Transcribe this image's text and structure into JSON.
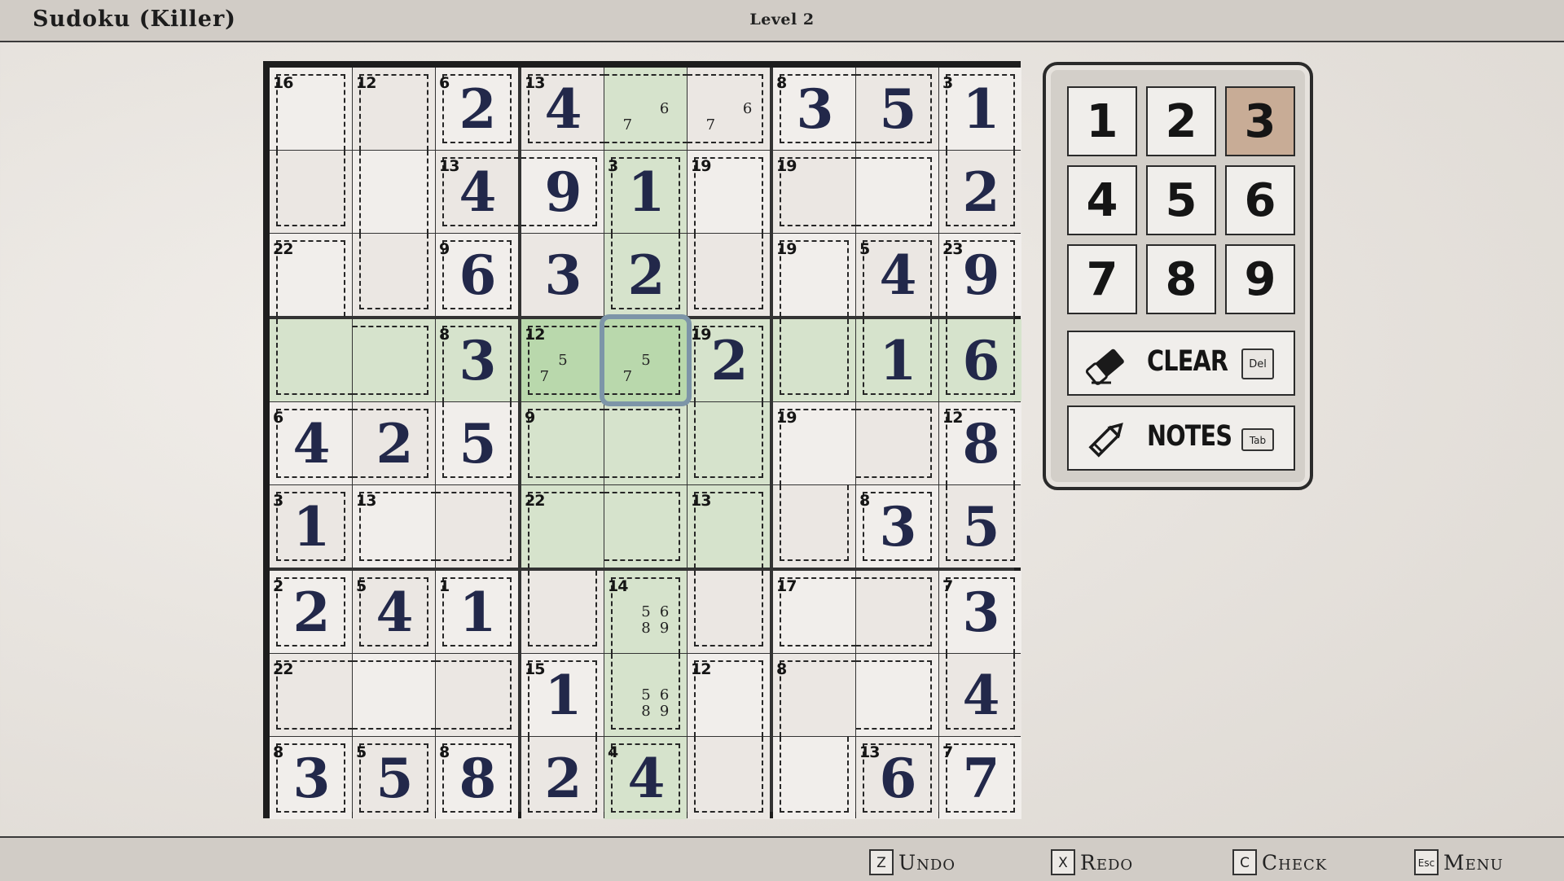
{
  "header": {
    "title": "Sudoku (Killer)",
    "level": "Level 2"
  },
  "colors": {
    "highlight": "#d6e3cc",
    "selected_fill": "#b9d8ac",
    "selected_ring": "#7d95a8",
    "active_number": "#c8ac96",
    "cell": "#f1eeeb",
    "cell_alt": "#ebe7e3"
  },
  "board": {
    "selected_cell": [
      3,
      4
    ],
    "active_number": 3,
    "values": [
      [
        null,
        null,
        2,
        4,
        null,
        null,
        3,
        5,
        1
      ],
      [
        null,
        null,
        4,
        9,
        1,
        null,
        null,
        null,
        2
      ],
      [
        null,
        null,
        6,
        3,
        2,
        null,
        null,
        4,
        9
      ],
      [
        null,
        null,
        3,
        null,
        null,
        2,
        null,
        1,
        6
      ],
      [
        4,
        2,
        5,
        null,
        null,
        null,
        null,
        null,
        8
      ],
      [
        1,
        null,
        null,
        null,
        null,
        null,
        null,
        3,
        5
      ],
      [
        2,
        4,
        1,
        null,
        null,
        null,
        null,
        null,
        3
      ],
      [
        null,
        null,
        null,
        1,
        null,
        null,
        null,
        null,
        4
      ],
      [
        3,
        5,
        8,
        2,
        4,
        null,
        null,
        6,
        7
      ]
    ],
    "notes": [
      {
        "row": 0,
        "col": 4,
        "digits": [
          6,
          7
        ]
      },
      {
        "row": 0,
        "col": 5,
        "digits": [
          6,
          7
        ]
      },
      {
        "row": 3,
        "col": 3,
        "digits": [
          5,
          7
        ]
      },
      {
        "row": 3,
        "col": 4,
        "digits": [
          5,
          7
        ]
      },
      {
        "row": 6,
        "col": 4,
        "digits": [
          5,
          6,
          8,
          9
        ]
      },
      {
        "row": 7,
        "col": 4,
        "digits": [
          5,
          6,
          8,
          9
        ]
      }
    ],
    "cages": [
      {
        "sum": 16,
        "cells": [
          [
            0,
            0
          ],
          [
            1,
            0
          ]
        ]
      },
      {
        "sum": 12,
        "cells": [
          [
            0,
            1
          ],
          [
            1,
            1
          ],
          [
            2,
            1
          ]
        ]
      },
      {
        "sum": 6,
        "cells": [
          [
            0,
            2
          ]
        ]
      },
      {
        "sum": 13,
        "cells": [
          [
            0,
            3
          ],
          [
            0,
            4
          ],
          [
            0,
            5
          ]
        ]
      },
      {
        "sum": 8,
        "cells": [
          [
            0,
            6
          ],
          [
            0,
            7
          ]
        ]
      },
      {
        "sum": 3,
        "cells": [
          [
            0,
            8
          ],
          [
            1,
            8
          ]
        ]
      },
      {
        "sum": 13,
        "cells": [
          [
            1,
            2
          ],
          [
            1,
            3
          ]
        ]
      },
      {
        "sum": 3,
        "cells": [
          [
            1,
            4
          ],
          [
            2,
            4
          ]
        ]
      },
      {
        "sum": 19,
        "cells": [
          [
            1,
            5
          ],
          [
            2,
            5
          ]
        ]
      },
      {
        "sum": 19,
        "cells": [
          [
            1,
            6
          ],
          [
            1,
            7
          ]
        ]
      },
      {
        "sum": 22,
        "cells": [
          [
            2,
            0
          ],
          [
            3,
            0
          ],
          [
            3,
            1
          ]
        ]
      },
      {
        "sum": 9,
        "cells": [
          [
            2,
            2
          ]
        ]
      },
      {
        "sum": 19,
        "cells": [
          [
            2,
            6
          ],
          [
            3,
            6
          ]
        ]
      },
      {
        "sum": 5,
        "cells": [
          [
            2,
            7
          ],
          [
            3,
            7
          ]
        ]
      },
      {
        "sum": 23,
        "cells": [
          [
            2,
            8
          ],
          [
            3,
            8
          ]
        ]
      },
      {
        "sum": 8,
        "cells": [
          [
            3,
            2
          ],
          [
            4,
            2
          ]
        ]
      },
      {
        "sum": 12,
        "cells": [
          [
            3,
            3
          ],
          [
            3,
            4
          ]
        ]
      },
      {
        "sum": 19,
        "cells": [
          [
            3,
            5
          ],
          [
            4,
            5
          ],
          [
            5,
            5
          ]
        ]
      },
      {
        "sum": 6,
        "cells": [
          [
            4,
            0
          ],
          [
            4,
            1
          ]
        ]
      },
      {
        "sum": 9,
        "cells": [
          [
            4,
            3
          ],
          [
            4,
            4
          ]
        ]
      },
      {
        "sum": 19,
        "cells": [
          [
            4,
            6
          ],
          [
            4,
            7
          ],
          [
            5,
            6
          ]
        ]
      },
      {
        "sum": 12,
        "cells": [
          [
            4,
            8
          ],
          [
            5,
            8
          ]
        ]
      },
      {
        "sum": 3,
        "cells": [
          [
            5,
            0
          ]
        ]
      },
      {
        "sum": 13,
        "cells": [
          [
            5,
            1
          ],
          [
            5,
            2
          ]
        ]
      },
      {
        "sum": 22,
        "cells": [
          [
            5,
            3
          ],
          [
            5,
            4
          ],
          [
            6,
            3
          ]
        ]
      },
      {
        "sum": 13,
        "cells": [
          [
            5,
            5
          ],
          [
            6,
            5
          ]
        ]
      },
      {
        "sum": 8,
        "cells": [
          [
            5,
            7
          ]
        ]
      },
      {
        "sum": 2,
        "cells": [
          [
            6,
            0
          ]
        ]
      },
      {
        "sum": 5,
        "cells": [
          [
            6,
            1
          ]
        ]
      },
      {
        "sum": 1,
        "cells": [
          [
            6,
            2
          ]
        ]
      },
      {
        "sum": 14,
        "cells": [
          [
            6,
            4
          ],
          [
            7,
            4
          ]
        ]
      },
      {
        "sum": 17,
        "cells": [
          [
            6,
            6
          ],
          [
            6,
            7
          ]
        ]
      },
      {
        "sum": 7,
        "cells": [
          [
            6,
            8
          ],
          [
            7,
            8
          ]
        ]
      },
      {
        "sum": 22,
        "cells": [
          [
            7,
            0
          ],
          [
            7,
            1
          ],
          [
            7,
            2
          ]
        ]
      },
      {
        "sum": 15,
        "cells": [
          [
            7,
            3
          ],
          [
            8,
            3
          ]
        ]
      },
      {
        "sum": 12,
        "cells": [
          [
            7,
            5
          ],
          [
            8,
            5
          ]
        ]
      },
      {
        "sum": 8,
        "cells": [
          [
            7,
            6
          ],
          [
            7,
            7
          ],
          [
            8,
            6
          ]
        ]
      },
      {
        "sum": 8,
        "cells": [
          [
            8,
            0
          ]
        ]
      },
      {
        "sum": 5,
        "cells": [
          [
            8,
            1
          ]
        ]
      },
      {
        "sum": 8,
        "cells": [
          [
            8,
            2
          ]
        ]
      },
      {
        "sum": 4,
        "cells": [
          [
            8,
            4
          ]
        ]
      },
      {
        "sum": 13,
        "cells": [
          [
            8,
            7
          ]
        ]
      },
      {
        "sum": 7,
        "cells": [
          [
            8,
            8
          ]
        ]
      }
    ]
  },
  "panel": {
    "numbers": [
      "1",
      "2",
      "3",
      "4",
      "5",
      "6",
      "7",
      "8",
      "9"
    ],
    "clear": {
      "label": "CLEAR",
      "key": "Del"
    },
    "notes": {
      "label": "NOTES",
      "key": "Tab"
    }
  },
  "footer": [
    {
      "key": "Z",
      "label": "Undo"
    },
    {
      "key": "X",
      "label": "Redo"
    },
    {
      "key": "C",
      "label": "Check"
    },
    {
      "key": "Esc",
      "label": "Menu"
    }
  ]
}
